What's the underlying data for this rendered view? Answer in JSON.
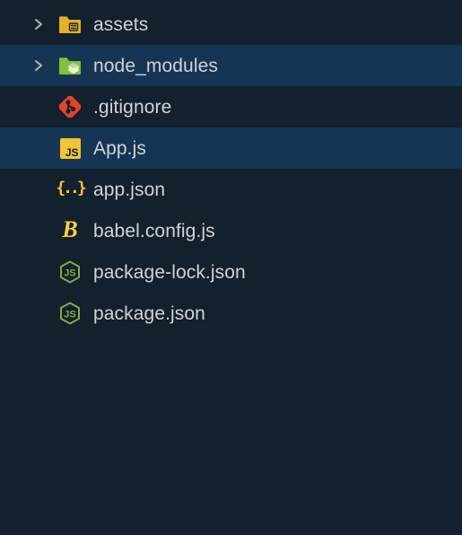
{
  "tree": {
    "items": [
      {
        "kind": "folder",
        "label": "assets",
        "icon": "folder-assets",
        "expandable": true,
        "selected": false
      },
      {
        "kind": "folder",
        "label": "node_modules",
        "icon": "folder-node-modules",
        "expandable": true,
        "selected": true
      },
      {
        "kind": "file",
        "label": ".gitignore",
        "icon": "git",
        "expandable": false,
        "selected": false
      },
      {
        "kind": "file",
        "label": "App.js",
        "icon": "js",
        "expandable": false,
        "selected": true
      },
      {
        "kind": "file",
        "label": "app.json",
        "icon": "json",
        "expandable": false,
        "selected": false
      },
      {
        "kind": "file",
        "label": "babel.config.js",
        "icon": "babel",
        "expandable": false,
        "selected": false
      },
      {
        "kind": "file",
        "label": "package-lock.json",
        "icon": "node",
        "expandable": false,
        "selected": false
      },
      {
        "kind": "file",
        "label": "package.json",
        "icon": "node",
        "expandable": false,
        "selected": false
      }
    ]
  }
}
